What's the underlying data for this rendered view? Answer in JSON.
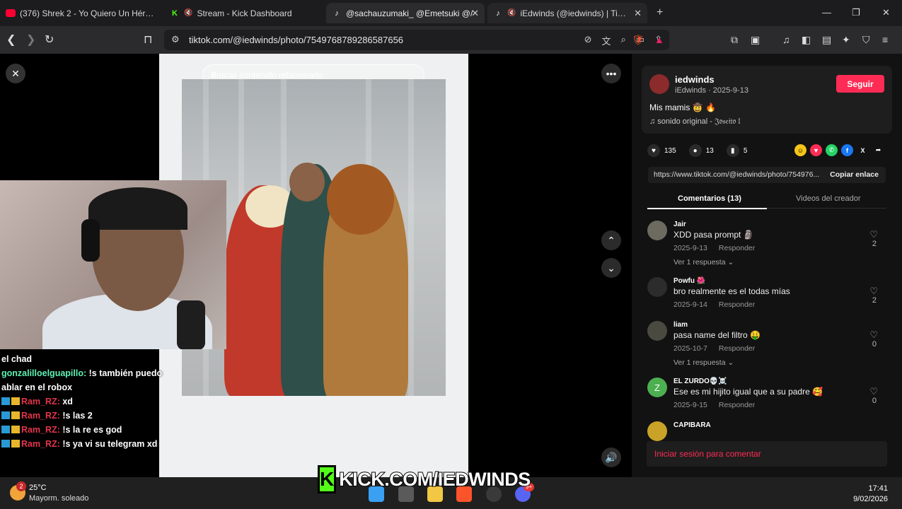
{
  "browser": {
    "tabs": [
      {
        "label": "(376) Shrek 2 - Yo Quiero Un Héroe (",
        "icon": "youtube-icon"
      },
      {
        "label": "Stream - Kick Dashboard",
        "icon": "kick-icon"
      },
      {
        "label": "@sachauzumaki_ @Emetsuki @/",
        "icon": "tiktok-icon"
      },
      {
        "label": "iEdwinds (@iedwinds) | TikTo",
        "icon": "tiktok-icon"
      }
    ],
    "url": "tiktok.com/@iedwinds/photo/7549768789286587656"
  },
  "viewer": {
    "search_placeholder": "Buscar contenido relacionado"
  },
  "chat": {
    "lines": [
      {
        "user": "",
        "text": "el chad"
      },
      {
        "user": "gonzalilloelguapillo:",
        "text": " !s también puedo"
      },
      {
        "user": "",
        "text": "ablar en el robox"
      },
      {
        "user": "Ram_RZ:",
        "text": " xd"
      },
      {
        "user": "Ram_RZ:",
        "text": " !s las 2"
      },
      {
        "user": "Ram_RZ:",
        "text": " !s la re es god"
      },
      {
        "user": "Ram_RZ:",
        "text": " !s ya vi su telegram xd"
      }
    ]
  },
  "post": {
    "author": "iedwinds",
    "author_sub": "iEdwinds · 2025-9-13",
    "follow_label": "Seguir",
    "caption": "Mis mamis 🤠 🔥",
    "music": "♫  sonido original - 𝔍𝔬𝔰𝔢𝔦𝔱𝔬 𝔩",
    "likes": "135",
    "comments_count": "13",
    "saves": "5",
    "link": "https://www.tiktok.com/@iedwinds/photo/754976...",
    "copy_label": "Copiar enlace",
    "tab_comments": "Comentarios (13)",
    "tab_creator": "Videos del creador"
  },
  "comments": [
    {
      "name": "Jair",
      "text": "XDD pasa prompt 🗿",
      "date": "2025-9-13",
      "reply": "Responder",
      "more": "Ver 1 respuesta ⌄",
      "likes": "2",
      "avatar_letter": ""
    },
    {
      "name": "Powfu 🌺",
      "text": "bro realmente es el todas mías",
      "date": "2025-9-14",
      "reply": "Responder",
      "more": "",
      "likes": "2",
      "avatar_letter": ""
    },
    {
      "name": "liam",
      "text": "pasa name del filtro 🤑",
      "date": "2025-10-7",
      "reply": "Responder",
      "more": "Ver 1 respuesta ⌄",
      "likes": "0",
      "avatar_letter": ""
    },
    {
      "name": "EL ZURDO💀☠️",
      "text": "Ese es mi hijito igual que a su padre 🥰",
      "date": "2025-9-15",
      "reply": "Responder",
      "more": "",
      "likes": "0",
      "avatar_letter": "Z"
    },
    {
      "name": "CAPIBARA",
      "text": "",
      "date": "",
      "reply": "",
      "more": "",
      "likes": "",
      "avatar_letter": ""
    }
  ],
  "login_prompt": "Iniciar sesión para comentar",
  "overlay": {
    "kick_text": "KICK.COM/IEDWINDS",
    "kick_logo": "K"
  },
  "taskbar": {
    "temp": "25°C",
    "condition": "Mayorm. soleado",
    "weather_badge": "2",
    "time": "17:41",
    "date": "9/02/2026",
    "discord_badge": "9+"
  },
  "colors": {
    "accent": "#fe2c55",
    "kick_green": "#53fc18"
  }
}
